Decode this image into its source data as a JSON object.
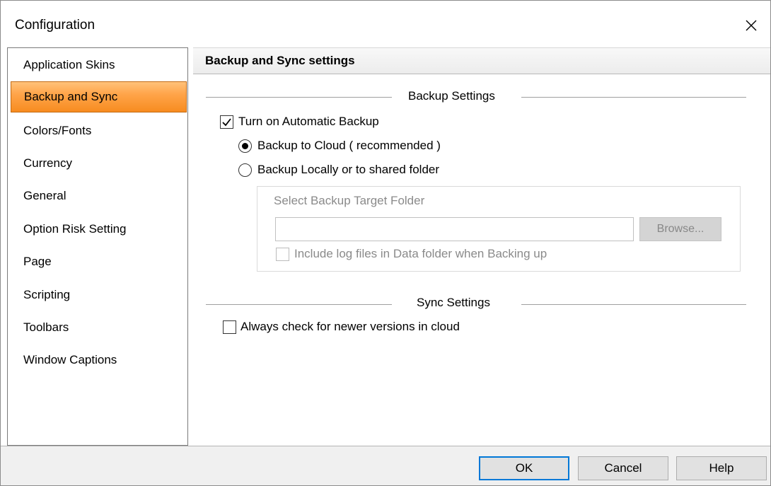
{
  "window": {
    "title": "Configuration"
  },
  "sidebar": {
    "items": [
      {
        "label": "Application Skins",
        "active": false
      },
      {
        "label": "Backup and Sync",
        "active": true
      },
      {
        "label": "Colors/Fonts",
        "active": false
      },
      {
        "label": "Currency",
        "active": false
      },
      {
        "label": "General",
        "active": false
      },
      {
        "label": "Option Risk Setting",
        "active": false
      },
      {
        "label": "Page",
        "active": false
      },
      {
        "label": "Scripting",
        "active": false
      },
      {
        "label": "Toolbars",
        "active": false
      },
      {
        "label": "Window Captions",
        "active": false
      }
    ]
  },
  "panel": {
    "header": "Backup and Sync settings",
    "backup_section": "Backup Settings",
    "auto_backup": {
      "label": "Turn on Automatic Backup",
      "checked": true
    },
    "radio_cloud": {
      "label": "Backup to Cloud ( recommended )",
      "selected": true
    },
    "radio_local": {
      "label": "Backup Locally or to shared folder",
      "selected": false
    },
    "target_folder": {
      "group_label": "Select Backup Target Folder",
      "value": "",
      "browse_label": "Browse...",
      "include_logs": {
        "label": "Include log files in Data folder when Backing up",
        "checked": false
      }
    },
    "sync_section": "Sync Settings",
    "check_newer": {
      "label": "Always check for newer versions in cloud",
      "checked": false
    }
  },
  "footer": {
    "ok_label": "OK",
    "cancel_label": "Cancel",
    "help_label": "Help"
  },
  "colors": {
    "active_item": "#f89a35",
    "default_button_border": "#0078d7"
  }
}
